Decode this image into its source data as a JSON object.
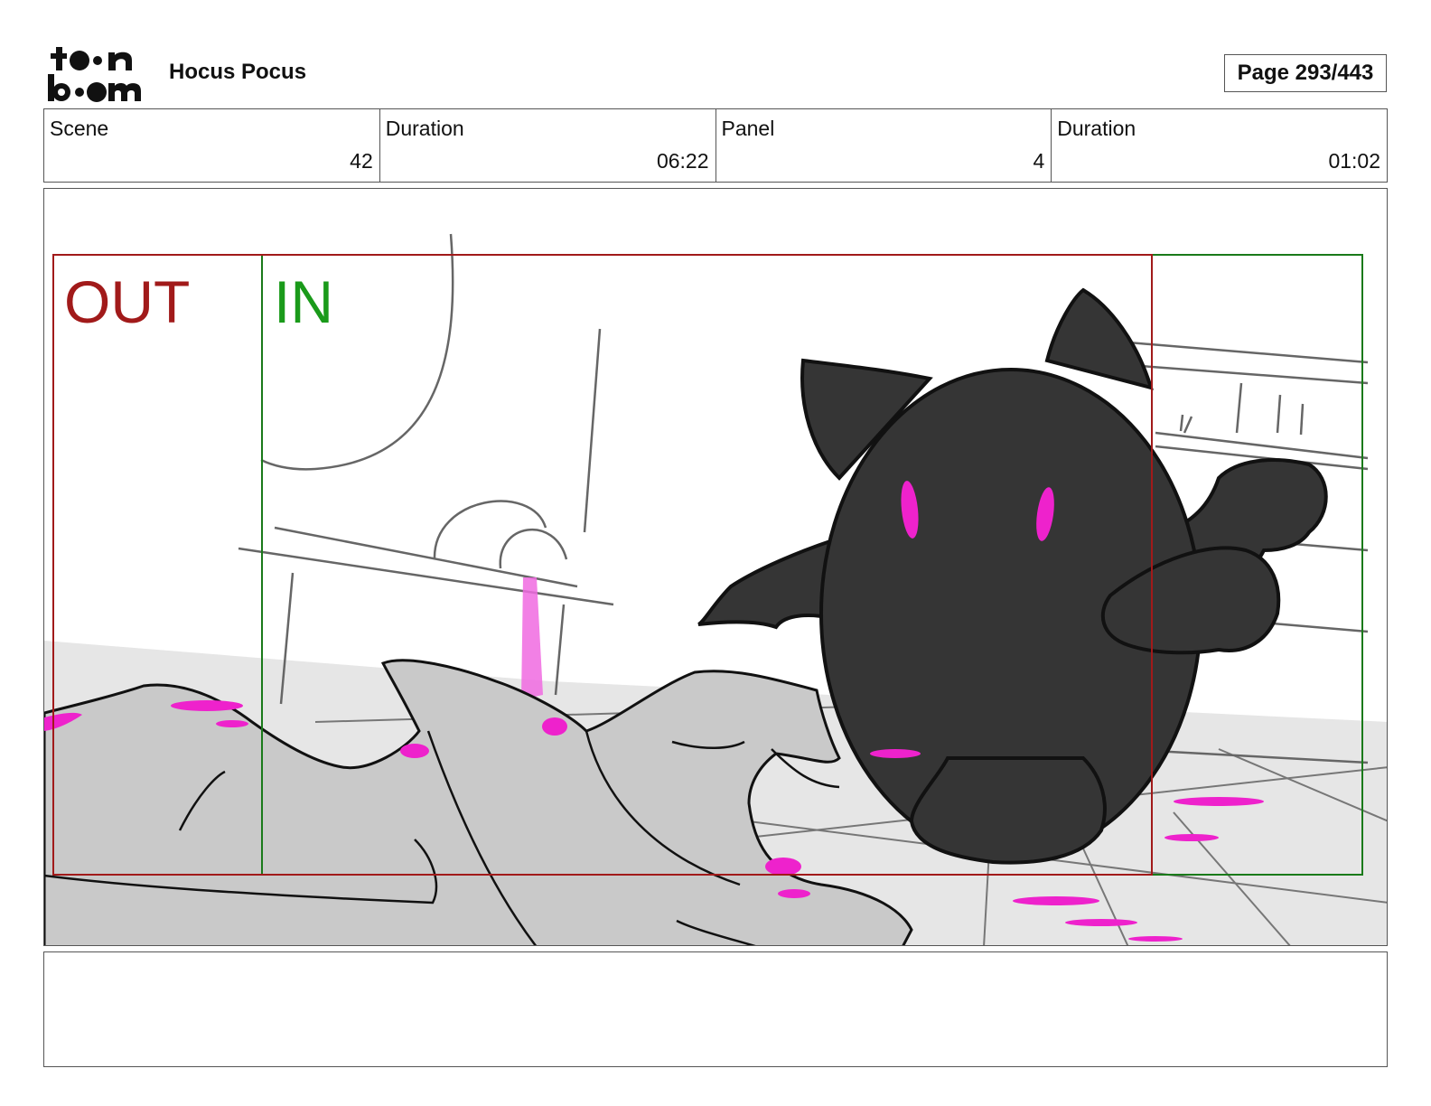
{
  "header": {
    "logo_text_top": "toon",
    "logo_text_bottom": "boom",
    "project_title": "Hocus Pocus",
    "page_label": "Page 293/443"
  },
  "info": {
    "scene_label": "Scene",
    "scene_value": "42",
    "scene_duration_label": "Duration",
    "scene_duration_value": "06:22",
    "panel_label": "Panel",
    "panel_value": "4",
    "panel_duration_label": "Duration",
    "panel_duration_value": "01:02"
  },
  "panel": {
    "out_label": "OUT",
    "in_label": "IN",
    "colors": {
      "out_frame": "#a11a1a",
      "in_frame": "#1a7a1a",
      "creature": "#353535",
      "eyes": "#ee22cc",
      "cloth": "#c9c9c9",
      "floor": "#e6e6e6"
    }
  },
  "notes": {
    "text": ""
  }
}
